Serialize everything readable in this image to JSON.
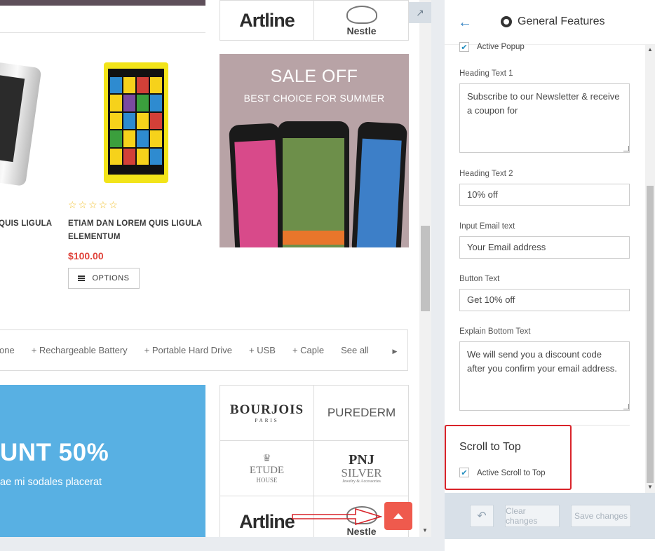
{
  "store": {
    "products": [
      {
        "title_line1": "QUIS LIGULA"
      },
      {
        "title_line1": "ETIAM DAN LOREM QUIS LIGULA",
        "title_line2": "ELEMENTUM",
        "price": "$100.00",
        "rating_stars": "☆☆☆☆☆",
        "options_label": "OPTIONS"
      }
    ],
    "sale_banner": {
      "heading": "SALE OFF",
      "subheading": "BEST CHOICE FOR SUMMER"
    },
    "tags": [
      "one",
      "+ Rechargeable Battery",
      "+ Portable Hard Drive",
      "+ USB",
      "+ Caple",
      "See all"
    ],
    "discount_banner": {
      "big": "UNT 50%",
      "small": "ae mi sodales placerat"
    },
    "brands": {
      "artline": "Artline",
      "nestle": "Nestle",
      "bourjois": "BOURJOIS",
      "bourjois_sub": "PARIS",
      "purederm": "PUREDERM",
      "etude": "ETUDE",
      "etude_sub": "HOUSE",
      "pnj": "PNJ",
      "pnj_sub": "SILVER",
      "pnj_tag": "Jewelry & Accessories"
    },
    "expand_icon": "↗"
  },
  "panel": {
    "title": "General Features",
    "back_icon": "←",
    "active_popup_label": "Active Popup",
    "heading_text_1": {
      "label": "Heading Text 1",
      "value": "Subscribe to our Newsletter & receive a coupon for"
    },
    "heading_text_2": {
      "label": "Heading Text 2",
      "value": "10% off"
    },
    "input_email": {
      "label": "Input Email text",
      "value": "Your Email address"
    },
    "button_text": {
      "label": "Button Text",
      "value": "Get 10% off"
    },
    "explain_bottom": {
      "label": "Explain Bottom Text",
      "value": "We will send you a discount code after you confirm your email address."
    },
    "scroll_to_top": {
      "heading": "Scroll to Top",
      "checkbox_label": "Active Scroll to Top"
    },
    "footer": {
      "undo_icon": "↶",
      "clear": "Clear changes",
      "save": "Save changes"
    },
    "checkmark": "✔"
  }
}
